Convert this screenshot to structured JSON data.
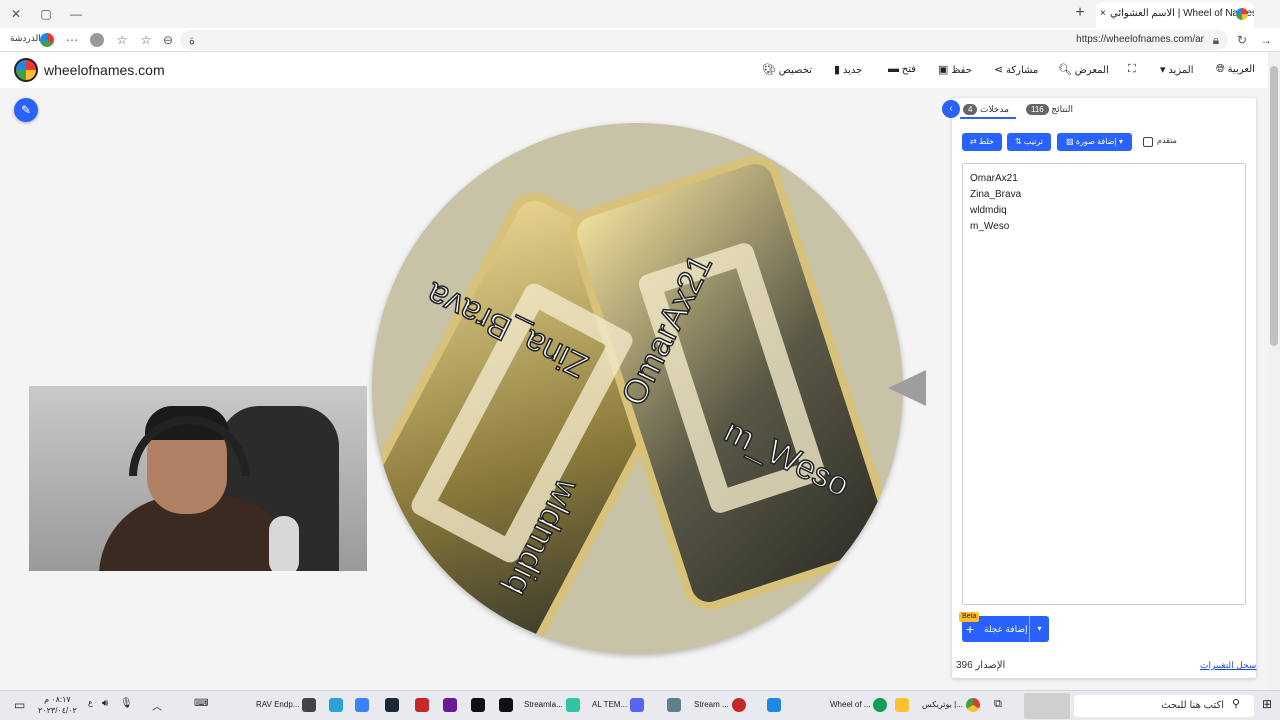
{
  "browser": {
    "tab_title": "الاسم العشوائي | Wheel of Names",
    "tab_close": "×",
    "new_tab": "+",
    "url": "https://wheelofnames.com/ar",
    "profile_label": "الدردشة",
    "window_controls": [
      "✕",
      "▢",
      "—"
    ]
  },
  "site": {
    "name": "wheelofnames.com",
    "nav": {
      "customize": "تخصيص",
      "new": "جديد",
      "open": "فتح",
      "save": "حفظ",
      "share": "مشاركة",
      "gallery": "المعرض",
      "more": "المزيد",
      "language": "العربية"
    }
  },
  "wheel": {
    "entries": [
      "OmarAx21",
      "Zina_Brava",
      "wldmdiq",
      "m_Weso"
    ]
  },
  "panel": {
    "tab_entries_label": "مدخلات",
    "tab_entries_count": "4",
    "tab_results_label": "النتائج",
    "tab_results_count": "116",
    "shuffle_label": "خلط",
    "sort_label": "ترتيب",
    "add_image_label": "إضافة صورة",
    "advanced_label": "متقدم",
    "entries_text": "OmarAx21\nZina_Brava\nwldmdiq\nm_Weso",
    "add_layer_label": "إضافة عجلة",
    "beta_label": "Beta",
    "version_label": "الإصدار 396",
    "changelog_label": "سجل التغييرات"
  },
  "taskbar": {
    "search_placeholder": "اكتب هنا للبحث",
    "clock_time": "٠٨:١٧ م",
    "clock_date": "٢٠٢٣/٠٤/٠٢",
    "items": [
      "بوتريكس |...",
      "Wheel of ...",
      "Stream ...",
      "AL TEM...",
      "Streamla...",
      "RAV Endp..."
    ]
  },
  "colors": {
    "accent": "#2962ff",
    "beta": "#fbc02d",
    "pointer": "#9e9e9e"
  }
}
